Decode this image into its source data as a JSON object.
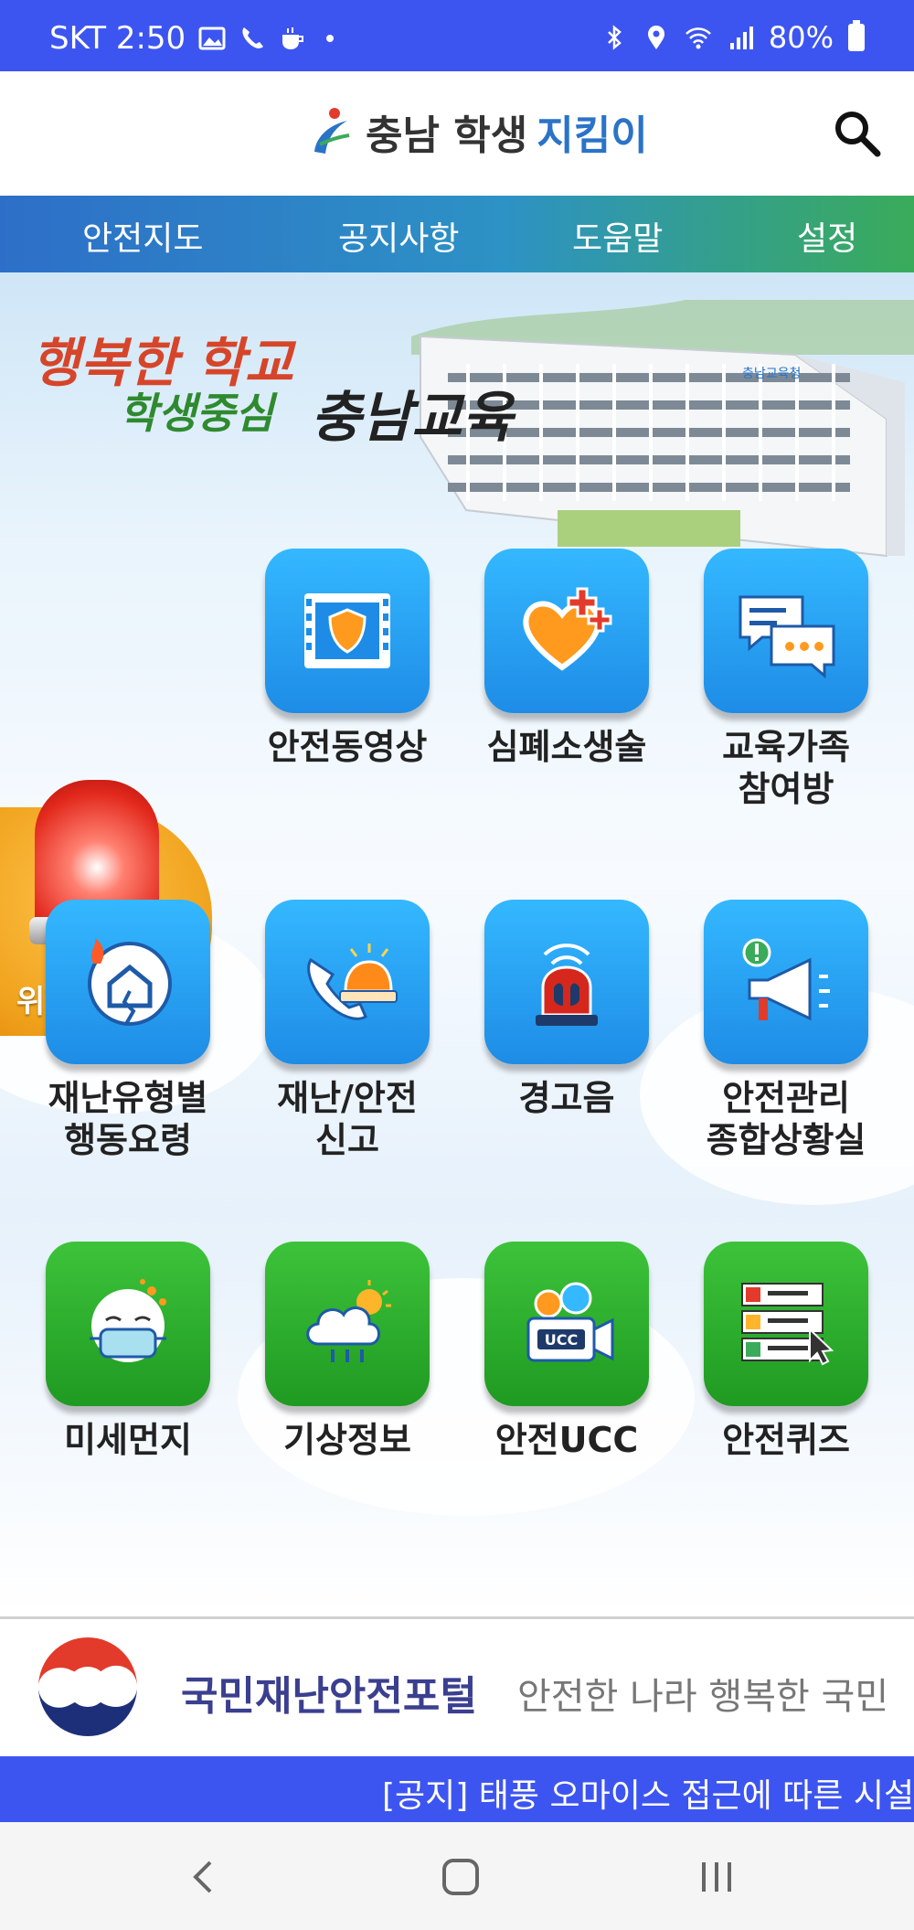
{
  "status_bar": {
    "carrier_time": "SKT 2:50",
    "battery": "80%",
    "icons": [
      "image-icon",
      "phone-icon",
      "cup-icon",
      "dot-icon",
      "bluetooth-icon",
      "location-icon",
      "wifi-icon",
      "signal-icon",
      "battery-icon"
    ]
  },
  "header": {
    "title_part1": "충남 학생",
    "title_part2": "지킴이"
  },
  "nav": {
    "items": [
      "안전지도",
      "공지사항",
      "도움말",
      "설정"
    ]
  },
  "banner": {
    "slogan_line1": "행복한 학교",
    "slogan_line2": "학생중심",
    "slogan_line3": "충남교육",
    "building_sign": "충남교육청"
  },
  "alert": {
    "label": "위험발생 알림"
  },
  "tiles": [
    {
      "label": "안전동영상",
      "color": "blue",
      "icon": "film-shield-icon"
    },
    {
      "label": "심폐소생술",
      "color": "blue",
      "icon": "heart-plus-icon"
    },
    {
      "label": "교육가족\n참여방",
      "color": "blue",
      "icon": "chat-bubbles-icon"
    },
    {
      "label": "재난유형별\n행동요령",
      "color": "blue",
      "icon": "earthquake-house-icon"
    },
    {
      "label": "재난/안전\n신고",
      "color": "blue",
      "icon": "phone-siren-icon"
    },
    {
      "label": "경고음",
      "color": "blue",
      "icon": "alarm-siren-icon"
    },
    {
      "label": "안전관리\n종합상황실",
      "color": "blue",
      "icon": "megaphone-icon"
    },
    {
      "label": "미세먼지",
      "color": "green",
      "icon": "mask-face-icon"
    },
    {
      "label": "기상정보",
      "color": "green",
      "icon": "weather-cloud-icon"
    },
    {
      "label": "안전UCC",
      "color": "green",
      "icon": "ucc-camera-icon",
      "badge": "UCC"
    },
    {
      "label": "안전퀴즈",
      "color": "green",
      "icon": "quiz-checklist-icon"
    }
  ],
  "portal": {
    "name": "국민재난안전포털",
    "motto": "안전한 나라 행복한 국민"
  },
  "notice": {
    "text": "[공지] 태풍 오마이스 접근에 따른 시설"
  },
  "colors": {
    "status_bar": "#3d55f0",
    "tile_blue": "#1e8ce6",
    "tile_green": "#1f9a22",
    "alert_orange": "#f0a21c"
  }
}
